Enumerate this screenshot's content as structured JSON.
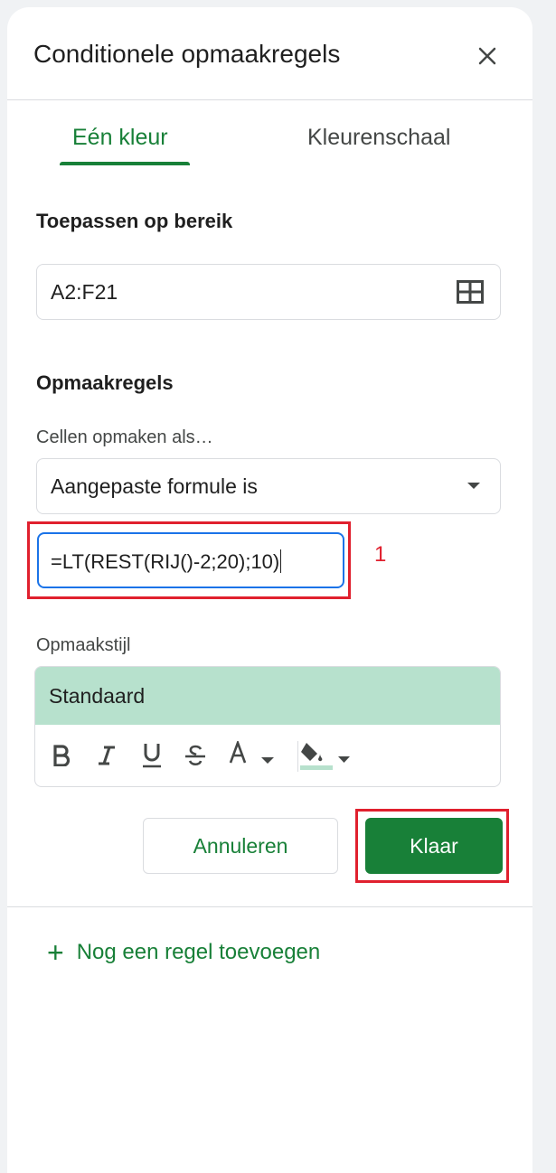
{
  "panel": {
    "title": "Conditionele opmaakregels",
    "close_icon": "close-icon"
  },
  "tabs": [
    {
      "label": "Eén kleur",
      "active": true
    },
    {
      "label": "Kleurenschaal",
      "active": false
    }
  ],
  "range": {
    "label": "Toepassen op bereik",
    "value": "A2:F21",
    "icon": "grid-select-icon"
  },
  "rules": {
    "label": "Opmaakregels",
    "condition_label": "Cellen opmaken als…",
    "condition_value": "Aangepaste formule is",
    "formula_value": "=LT(REST(RIJ()-2;20);10)"
  },
  "style": {
    "label": "Opmaakstijl",
    "preview_label": "Standaard",
    "preview_color": "#b7e1cd",
    "toolbar": [
      "bold-icon",
      "italic-icon",
      "underline-icon",
      "strikethrough-icon",
      "text-color-icon",
      "fill-color-icon"
    ]
  },
  "buttons": {
    "cancel": "Annuleren",
    "done": "Klaar"
  },
  "add_rule": {
    "label": "Nog een regel toevoegen"
  },
  "annotations": {
    "marker_1": "1",
    "highlight_color": "#e0202e"
  },
  "colors": {
    "accent": "#188038",
    "focus": "#1a73e8"
  }
}
